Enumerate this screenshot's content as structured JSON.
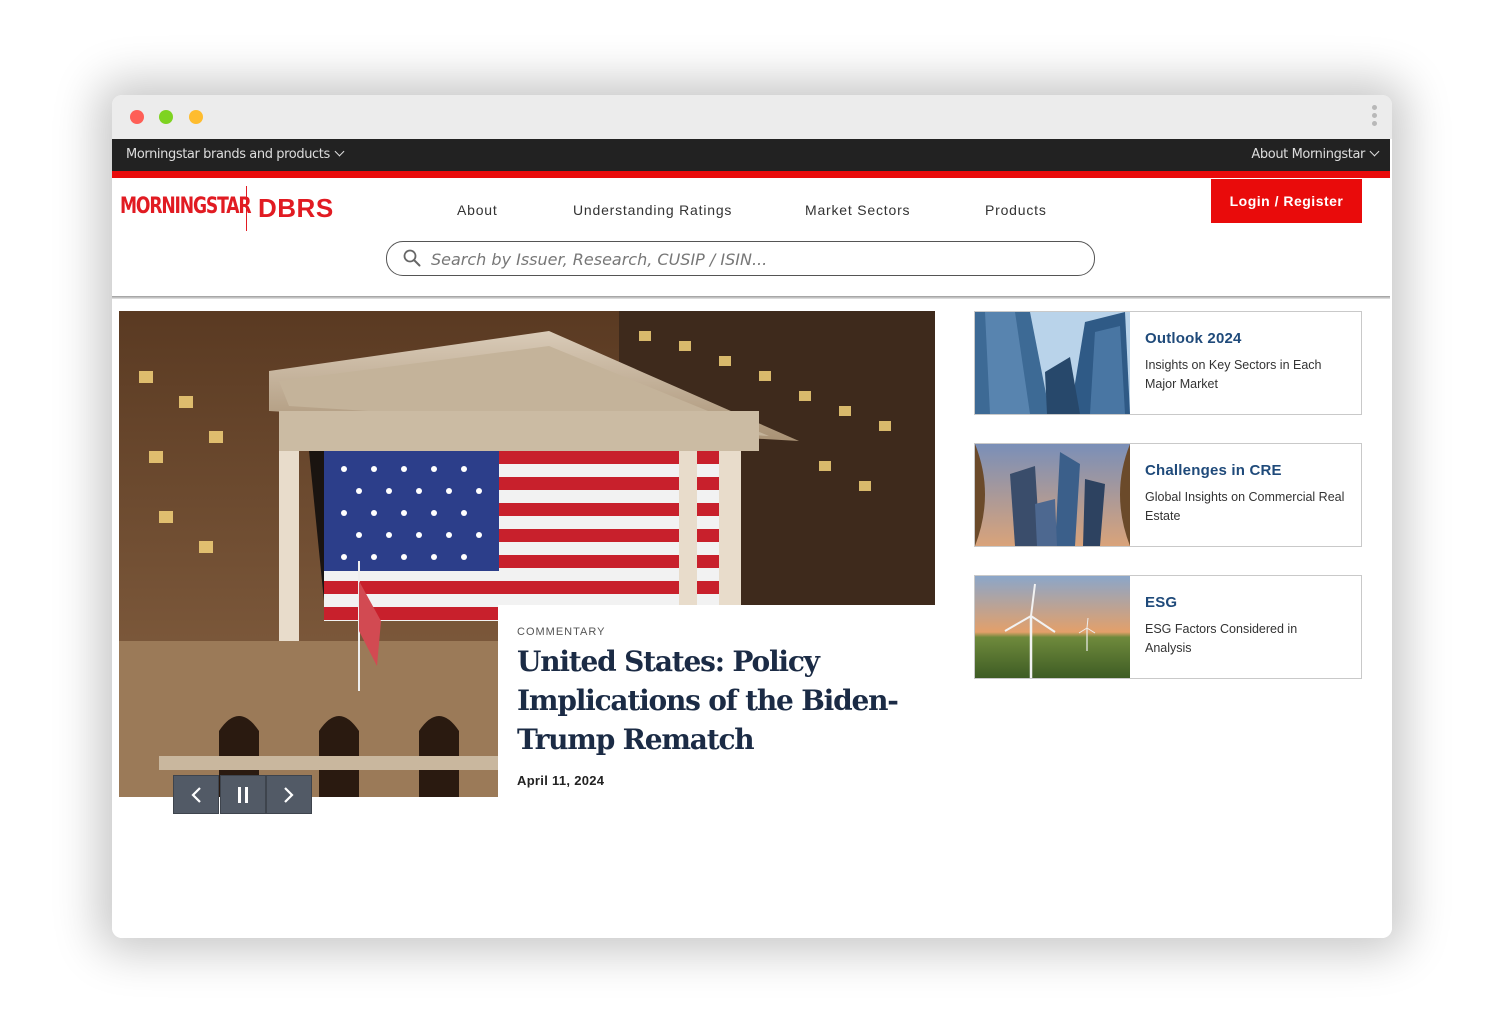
{
  "utility_bar": {
    "brands_label": "Morningstar brands and products",
    "about_label": "About Morningstar"
  },
  "logo": {
    "morningstar": "MORNINGSTAR",
    "dbrs": "DBRS"
  },
  "nav": {
    "items": [
      {
        "label": "About"
      },
      {
        "label": "Understanding Ratings"
      },
      {
        "label": "Market Sectors"
      },
      {
        "label": "Products"
      }
    ],
    "login_label": "Login / Register"
  },
  "search": {
    "placeholder": "Search by Issuer, Research, CUSIP / ISIN..."
  },
  "hero": {
    "tag": "COMMENTARY",
    "headline": "United States: Policy Implications of the Biden-Trump Rematch",
    "date": "April 11, 2024"
  },
  "cards": [
    {
      "title": "Outlook 2024",
      "description": "Insights on Key Sectors in Each Major Market"
    },
    {
      "title": "Challenges in CRE",
      "description": "Global Insights on Commercial Real Estate"
    },
    {
      "title": "ESG",
      "description": "ESG Factors Considered in Analysis"
    }
  ],
  "colors": {
    "brand_red": "#e90b0b",
    "utility_bar": "#222222",
    "headline_navy": "#1b2b45",
    "card_title_blue": "#1f4a7a"
  }
}
